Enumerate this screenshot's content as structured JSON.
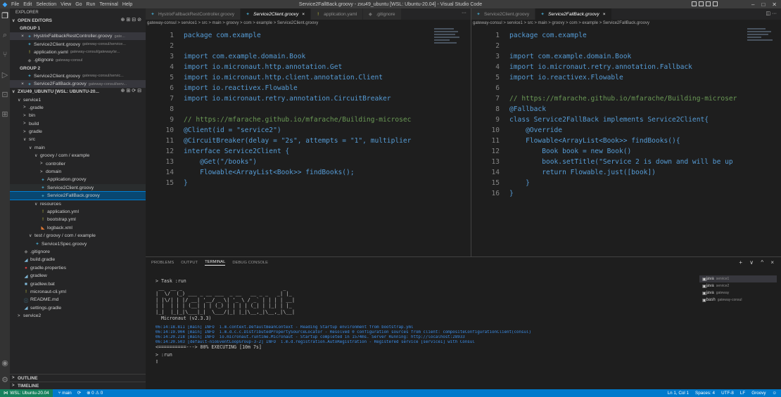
{
  "window": {
    "title": "Service2FallBack.groovy - zxu49_ubuntu [WSL: Ubuntu-20.04] - Visual Studio Code",
    "menu": [
      "File",
      "Edit",
      "Selection",
      "View",
      "Go",
      "Run",
      "Terminal",
      "Help"
    ]
  },
  "sidebar": {
    "title": "EXPLORER",
    "open_editors_label": "OPEN EDITORS",
    "group1_label": "GROUP 1",
    "group1_items": [
      {
        "name": "HystrixFallbackRestController.groovy",
        "path": "gate...",
        "prefix": "×",
        "icon": "groovy"
      },
      {
        "name": "Service2Client.groovy",
        "path": "gateway-consul/service...",
        "prefix": "",
        "icon": "groovy"
      },
      {
        "name": "application.yaml",
        "path": "gateway-consul/gateway/sr...",
        "prefix": "",
        "icon": "yml"
      },
      {
        "name": ".gitignore",
        "path": "gateway-consul",
        "prefix": "",
        "icon": "git"
      }
    ],
    "group2_label": "GROUP 2",
    "group2_items": [
      {
        "name": "Service2Client.groovy",
        "path": "gateway-consul/servic...",
        "prefix": "",
        "icon": "groovy"
      },
      {
        "name": "Service2FallBack.groovy",
        "path": "gateway-consul/serv...",
        "prefix": "×",
        "icon": "groovy"
      }
    ],
    "workspace_label": "ZXU49_UBUNTU [WSL: UBUNTU-20...",
    "tree": [
      {
        "label": "service1",
        "depth": 1,
        "chev": "∨",
        "icon": ""
      },
      {
        "label": ".gradle",
        "depth": 2,
        "chev": ">",
        "icon": ""
      },
      {
        "label": "bin",
        "depth": 2,
        "chev": ">",
        "icon": ""
      },
      {
        "label": "build",
        "depth": 2,
        "chev": ">",
        "icon": ""
      },
      {
        "label": "gradle",
        "depth": 2,
        "chev": ">",
        "icon": ""
      },
      {
        "label": "src",
        "depth": 2,
        "chev": "∨",
        "icon": ""
      },
      {
        "label": "main",
        "depth": 3,
        "chev": "∨",
        "icon": ""
      },
      {
        "label": "groovy / com / example",
        "depth": 4,
        "chev": "∨",
        "icon": ""
      },
      {
        "label": "controller",
        "depth": 5,
        "chev": ">",
        "icon": ""
      },
      {
        "label": "domain",
        "depth": 5,
        "chev": ">",
        "icon": ""
      },
      {
        "label": "Application.groovy",
        "depth": 5,
        "chev": "",
        "icon": "groovy"
      },
      {
        "label": "Service2Client.groovy",
        "depth": 5,
        "chev": "",
        "icon": "groovy"
      },
      {
        "label": "Service2FallBack.groovy",
        "depth": 5,
        "chev": "",
        "icon": "groovy"
      },
      {
        "label": "resources",
        "depth": 4,
        "chev": "∨",
        "icon": ""
      },
      {
        "label": "application.yml",
        "depth": 5,
        "chev": "",
        "icon": "yml"
      },
      {
        "label": "bootstrap.yml",
        "depth": 5,
        "chev": "",
        "icon": "yml"
      },
      {
        "label": "logback.xml",
        "depth": 5,
        "chev": "",
        "icon": "xml"
      },
      {
        "label": "test / groovy / com / example",
        "depth": 3,
        "chev": "∨",
        "icon": ""
      },
      {
        "label": "Service1Spec.groovy",
        "depth": 4,
        "chev": "",
        "icon": "groovy"
      },
      {
        "label": ".gitignore",
        "depth": 2,
        "chev": "",
        "icon": "git"
      },
      {
        "label": "build.gradle",
        "depth": 2,
        "chev": "",
        "icon": "gradle"
      },
      {
        "label": "gradle.properties",
        "depth": 2,
        "chev": "",
        "icon": "red"
      },
      {
        "label": "gradlew",
        "depth": 2,
        "chev": "",
        "icon": "gradle"
      },
      {
        "label": "gradlew.bat",
        "depth": 2,
        "chev": "",
        "icon": "bat"
      },
      {
        "label": "micronaut-cli.yml",
        "depth": 2,
        "chev": "",
        "icon": "yml"
      },
      {
        "label": "README.md",
        "depth": 2,
        "chev": "",
        "icon": "md"
      },
      {
        "label": "settings.gradle",
        "depth": 2,
        "chev": "",
        "icon": "gradle"
      },
      {
        "label": "service2",
        "depth": 1,
        "chev": ">",
        "icon": ""
      }
    ],
    "outline_label": "OUTLINE",
    "timeline_label": "TIMELINE"
  },
  "editor_left": {
    "tabs": [
      {
        "label": "HystrixFallbackRestController.groovy",
        "icon": "groovy",
        "active": false
      },
      {
        "label": "Service2Client.groovy",
        "icon": "groovy",
        "active": true,
        "close": "×"
      },
      {
        "label": "application.yaml",
        "icon": "yml",
        "active": false
      },
      {
        "label": ".gitignore",
        "icon": "git",
        "active": false
      }
    ],
    "more": "···",
    "breadcrumb": "gateway-consul > service1 > src > main > groovy > com > example > Service2Client.groovy",
    "lines": [
      {
        "n": "1",
        "t": "package com.example"
      },
      {
        "n": "2",
        "t": ""
      },
      {
        "n": "3",
        "t": "import com.example.domain.Book"
      },
      {
        "n": "4",
        "t": "import io.micronaut.http.annotation.Get"
      },
      {
        "n": "5",
        "t": "import io.micronaut.http.client.annotation.Client"
      },
      {
        "n": "6",
        "t": "import io.reactivex.Flowable"
      },
      {
        "n": "7",
        "t": "import io.micronaut.retry.annotation.CircuitBreaker"
      },
      {
        "n": "8",
        "t": ""
      },
      {
        "n": "9",
        "t": "// https://mfarache.github.io/mfarache/Building-microsec"
      },
      {
        "n": "10",
        "t": "@Client(id = \"service2\")"
      },
      {
        "n": "11",
        "t": "@CircuitBreaker(delay = \"2s\", attempts = \"1\", multiplier"
      },
      {
        "n": "12",
        "t": "interface Service2Client {"
      },
      {
        "n": "13",
        "t": "    @Get(\"/books\")"
      },
      {
        "n": "14",
        "t": "    Flowable<ArrayList<Book>> findBooks();"
      },
      {
        "n": "15",
        "t": "}"
      }
    ]
  },
  "editor_right": {
    "tabs": [
      {
        "label": "Service2Client.groovy",
        "icon": "groovy",
        "active": false
      },
      {
        "label": "Service2FallBack.groovy",
        "icon": "groovy",
        "active": true,
        "close": "×"
      }
    ],
    "more": "◫ ···",
    "breadcrumb": "gateway-consul > service1 > src > main > groovy > com > example > Service2FallBack.groovy",
    "lines": [
      {
        "n": "1",
        "t": "package com.example"
      },
      {
        "n": "2",
        "t": ""
      },
      {
        "n": "3",
        "t": "import com.example.domain.Book"
      },
      {
        "n": "4",
        "t": "import io.micronaut.retry.annotation.Fallback"
      },
      {
        "n": "5",
        "t": "import io.reactivex.Flowable"
      },
      {
        "n": "6",
        "t": ""
      },
      {
        "n": "7",
        "t": "// https://mfarache.github.io/mfarache/Building-microser"
      },
      {
        "n": "8",
        "t": "@Fallback"
      },
      {
        "n": "9",
        "t": "class Service2FallBack implements Service2Client{"
      },
      {
        "n": "10",
        "t": "    @Override"
      },
      {
        "n": "11",
        "t": "    Flowable<ArrayList<Book>> findBooks(){"
      },
      {
        "n": "12",
        "t": "        Book book = new Book()"
      },
      {
        "n": "13",
        "t": "        book.setTitle(\"Service 2 is down and will be up"
      },
      {
        "n": "14",
        "t": "        return Flowable.just([book])"
      },
      {
        "n": "15",
        "t": "    }"
      },
      {
        "n": "16",
        "t": "}"
      }
    ]
  },
  "panel": {
    "tabs": [
      "PROBLEMS",
      "OUTPUT",
      "TERMINAL",
      "DEBUG CONSOLE"
    ],
    "active_tab": "TERMINAL",
    "actions": "+ ∨ ^ ×",
    "task": "> Task :run",
    "logo_lines": [
      " __  __ _                                  _   ",
      "|  \\/  (_) ___ _ __ ___  _ __   __ _ _   _| |_ ",
      "| |\\/| | |/ __| '__/ _ \\| '_ \\ / _` | | | | __|",
      "| |  | | | (__| | | (_) | | | | (_| | |_| | |_ ",
      "|_|  |_|_|\\___|_|  \\___/|_| |_|\\__,_|\\__,_|\\__|"
    ],
    "version": "  Micronaut (v2.3.3)",
    "logs": [
      "06:14:18.811 [main] INFO  i.m.context.DefaultBeanContext - Reading Startup environment from bootstrap.yml",
      "06:14:19.904 [main] INFO  i.m.d.c.c.DistributedPropertySourceLocator - Resolved 0 configuration sources from client: compositeConfigurationClient(consul)",
      "06:14:20.218 [main] INFO  io.micronaut.runtime.Micronaut - Startup completed in 1574ms. Server Running: http://localhost:28933",
      "06:14:20.503 [default-nioEventLoopGroup-3-2] INFO  i.m.d.registration.AutoRegistration - Registered service [service1] with Consul"
    ],
    "progress": "<==========---> 80% EXECUTING [10m 7s]",
    "run_line": "> :run",
    "cursor": "▯",
    "terminals": [
      {
        "name": "java",
        "sub": "service1",
        "selected": true
      },
      {
        "name": "java",
        "sub": "service2",
        "selected": false
      },
      {
        "name": "java",
        "sub": "gateway",
        "selected": false
      },
      {
        "name": "bash",
        "sub": "gateway-consul",
        "selected": false
      }
    ]
  },
  "status": {
    "remote": "WSL: Ubuntu-20.04",
    "branch": "main",
    "sync": "⟳",
    "problems": "⊗ 0 ⚠ 0",
    "position": "Ln 1, Col 1",
    "spaces": "Spaces: 4",
    "encoding": "UTF-8",
    "eol": "LF",
    "language": "Groovy"
  }
}
